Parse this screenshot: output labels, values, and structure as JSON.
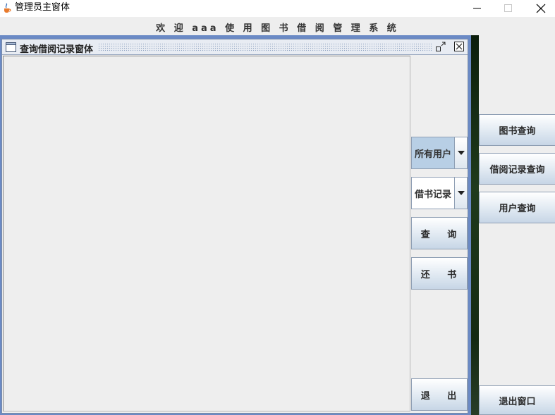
{
  "window": {
    "title": "管理员主窗体",
    "minimize_symbol": "—",
    "maximize_symbol": "☐",
    "close_symbol": "✕"
  },
  "welcome": "欢 迎 aaa 使 用 图 书 借 阅 管 理 系 统",
  "internal_frame": {
    "title": "查询借阅记录窗体",
    "user_combo": {
      "selected": "所有用户"
    },
    "record_combo": {
      "selected": "借书记录"
    },
    "query_button": "查 询",
    "return_button": "还 书",
    "exit_button": "退 出"
  },
  "side_menu": {
    "book_query": "图书查询",
    "borrow_record_query": "借阅记录查询",
    "user_query": "用户查询",
    "exit_window": "退出窗口"
  },
  "icons": {
    "app": "java-cup-icon",
    "frame": "window-icon",
    "restore": "restore-icon",
    "close": "close-icon",
    "combo_arrow": "triangle-down-icon"
  }
}
